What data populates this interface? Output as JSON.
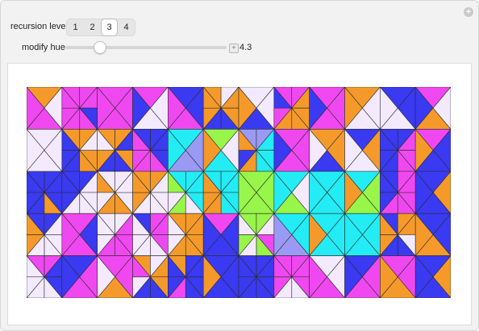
{
  "controls": {
    "recursion_label": "recursion level",
    "recursion_options": [
      "1",
      "2",
      "3",
      "4"
    ],
    "recursion_selected": "3",
    "hue_label": "modify hue",
    "hue_value": 4.3,
    "hue_value_text": "4.3",
    "hue_min": 0,
    "hue_max": 20
  },
  "tiling": {
    "palette": [
      "#f048f0",
      "#3a3af2",
      "#f59a2a",
      "#f4eaff",
      "#9a9af5",
      "#23ecf5",
      "#98f54a"
    ],
    "stroke": "#2b2b2b"
  }
}
